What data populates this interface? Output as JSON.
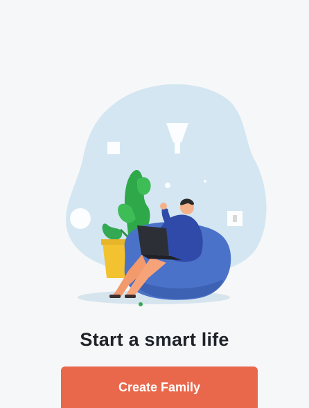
{
  "onboarding": {
    "headline": "Start a smart life",
    "create_button_label": "Create Family",
    "illustration_icon": "person-on-beanbag-with-laptop-illustration",
    "pager": {
      "page_count": 1,
      "active_index": 0
    }
  },
  "colors": {
    "background": "#f6f7f8",
    "button": "#e9674a",
    "button_text": "#ffffff",
    "headline": "#1f2329",
    "pager_active": "#34a853",
    "blob": "#d3e6f2",
    "beanbag": "#4a72c8",
    "plant": "#3ab14a",
    "pot": "#f2c230"
  }
}
